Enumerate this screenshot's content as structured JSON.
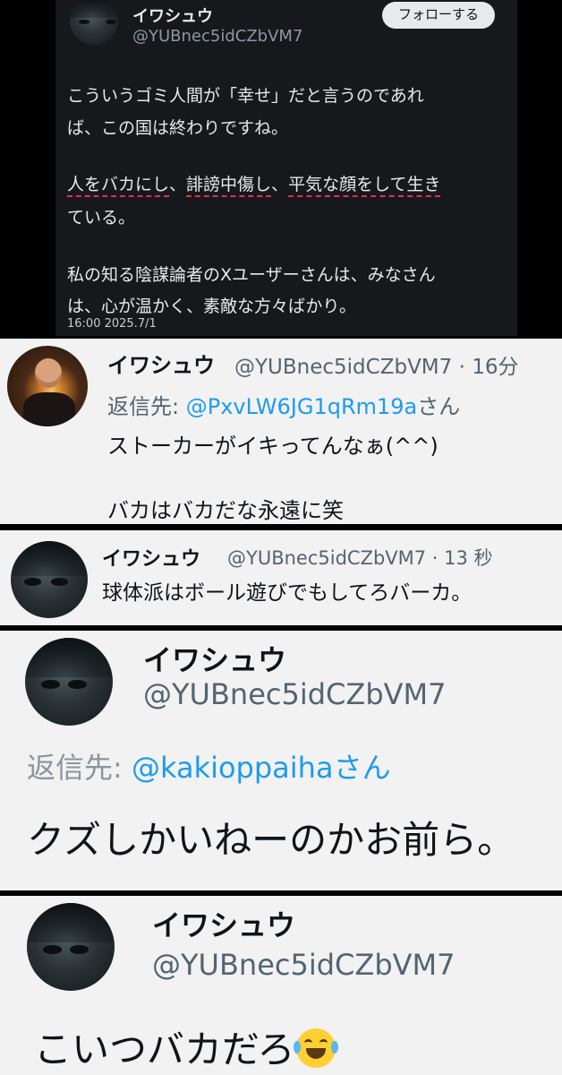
{
  "tweet1": {
    "display_name": "イワシュウ",
    "handle": "@YUBnec5idCZbVM7",
    "follow_button": "フォローする",
    "line1": "こういうゴミ人間が「幸せ」だと言うのであれ",
    "line2": "ば、この国は終わりですね。",
    "line3_part1": "人をバカにし",
    "line3_sep1": "、",
    "line3_part2": "誹謗中傷し",
    "line3_sep2": "、",
    "line3_part3": "平気な顔をして生き",
    "line4": "ている。",
    "line5": "私の知る陰謀論者のXユーザーさんは、みなさん",
    "line6": "は、心が温かく、素敵な方々ばかり。",
    "timestamp": "16:00 2025.7/1"
  },
  "tweet2": {
    "display_name": "イワシュウ",
    "handle_time": "@YUBnec5idCZbVM7 · 16分",
    "reply_prefix": "返信先: ",
    "reply_to": "@PxvLW6JG1qRm19a",
    "reply_suffix": "さん",
    "line1": "ストーカーがイキってんなぁ(^^)",
    "line2": "バカはバカだな永遠に笑"
  },
  "tweet3": {
    "display_name": "イワシュウ",
    "handle_time": "@YUBnec5idCZbVM7 · 13 秒",
    "line1": "球体派はボール遊びでもしてろバーカ。"
  },
  "tweet4": {
    "display_name": "イワシュウ",
    "handle": "@YUBnec5idCZbVM7",
    "reply_prefix": "返信先: ",
    "reply_to": "@kakioppaiha",
    "reply_suffix": "さん",
    "line1": "クズしかいねーのかお前ら。"
  },
  "tweet5": {
    "display_name": "イワシュウ",
    "handle": "@YUBnec5idCZbVM7",
    "line1": "こいつバカだろ",
    "emoji": "face-with-tears-of-joy-icon"
  },
  "colors": {
    "dark_bg": "#16181c",
    "light_bg": "#f2f2f2",
    "link": "#1d9bf0",
    "underline": "#e0334a"
  }
}
